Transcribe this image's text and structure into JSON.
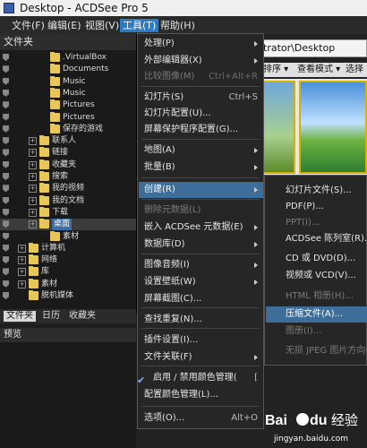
{
  "window": {
    "title": "Desktop - ACDSee Pro 5"
  },
  "menubar": {
    "items": [
      "文件(F)",
      "编辑(E)",
      "视图(V)",
      "工具(T)",
      "帮助(H)"
    ]
  },
  "folders": {
    "header": "文件夹",
    "tree": [
      ".VirtualBox",
      "Documents",
      "Music",
      "Music",
      "Pictures",
      "Pictures",
      "保存的游戏",
      "联系人",
      "链接",
      "收藏夹",
      "搜索",
      "我的视频",
      "我的文档",
      "下载",
      "桌面",
      "素材",
      "计算机",
      "网络",
      "库",
      "素材",
      "脱机媒体"
    ],
    "tabs": [
      "文件夹",
      "日历",
      "收藏夹"
    ]
  },
  "preview": {
    "header": "预览"
  },
  "content": {
    "path": "trator\\Desktop",
    "sort_label": "排序 ▾",
    "view_label": "查看模式 ▾",
    "select_label": "选择"
  },
  "tools_menu": {
    "items": [
      {
        "label": "处理(P)",
        "shortcut": ""
      },
      {
        "label": "外部编辑器(X)",
        "shortcut": ""
      },
      {
        "label": "比较图像(M)",
        "shortcut": "Ctrl+Alt+R"
      },
      {
        "label": "幻灯片(S)",
        "shortcut": "Ctrl+S"
      },
      {
        "label": "幻灯片配置(U)...",
        "shortcut": ""
      },
      {
        "label": "屏幕保护程序配置(G)...",
        "shortcut": ""
      },
      {
        "label": "地图(A)",
        "shortcut": ""
      },
      {
        "label": "批量(B)",
        "shortcut": ""
      },
      {
        "label": "创建(R)",
        "shortcut": ""
      },
      {
        "label": "删除元数据(L)",
        "shortcut": ""
      },
      {
        "label": "嵌入 ACDSee 元数据(E)",
        "shortcut": ""
      },
      {
        "label": "数据库(D)",
        "shortcut": ""
      },
      {
        "label": "图像音频(I)",
        "shortcut": ""
      },
      {
        "label": "设置壁纸(W)",
        "shortcut": ""
      },
      {
        "label": "屏幕截图(C)...",
        "shortcut": ""
      },
      {
        "label": "查找重复(N)...",
        "shortcut": ""
      },
      {
        "label": "插件设置(I)...",
        "shortcut": ""
      },
      {
        "label": "文件关联(F)",
        "shortcut": ""
      },
      {
        "label": "启用 / 禁用颜色管理(",
        "shortcut": "["
      },
      {
        "label": "配置颜色管理(L)...",
        "shortcut": ""
      },
      {
        "label": "选项(O)...",
        "shortcut": "Alt+O"
      }
    ]
  },
  "create_submenu": {
    "items": [
      "幻灯片文件(S)...",
      "PDF(P)...",
      "PPT(I)...",
      "ACDSee 陈列室(R)...",
      "CD 或 DVD(D)...",
      "视频或 VCD(V)...",
      "HTML 相册(H)...",
      "压缩文件(A)...",
      "图册(I)...",
      "无损 JPEG 图片方向(J)"
    ]
  },
  "watermark": {
    "brand": "Bai",
    "brand2": "du",
    "text": "经验",
    "url": "jingyan.baidu.com"
  },
  "colors": {
    "accent": "#3d6d99",
    "menubar_active": "#2b7cc4",
    "folder": "#e7c65a"
  }
}
